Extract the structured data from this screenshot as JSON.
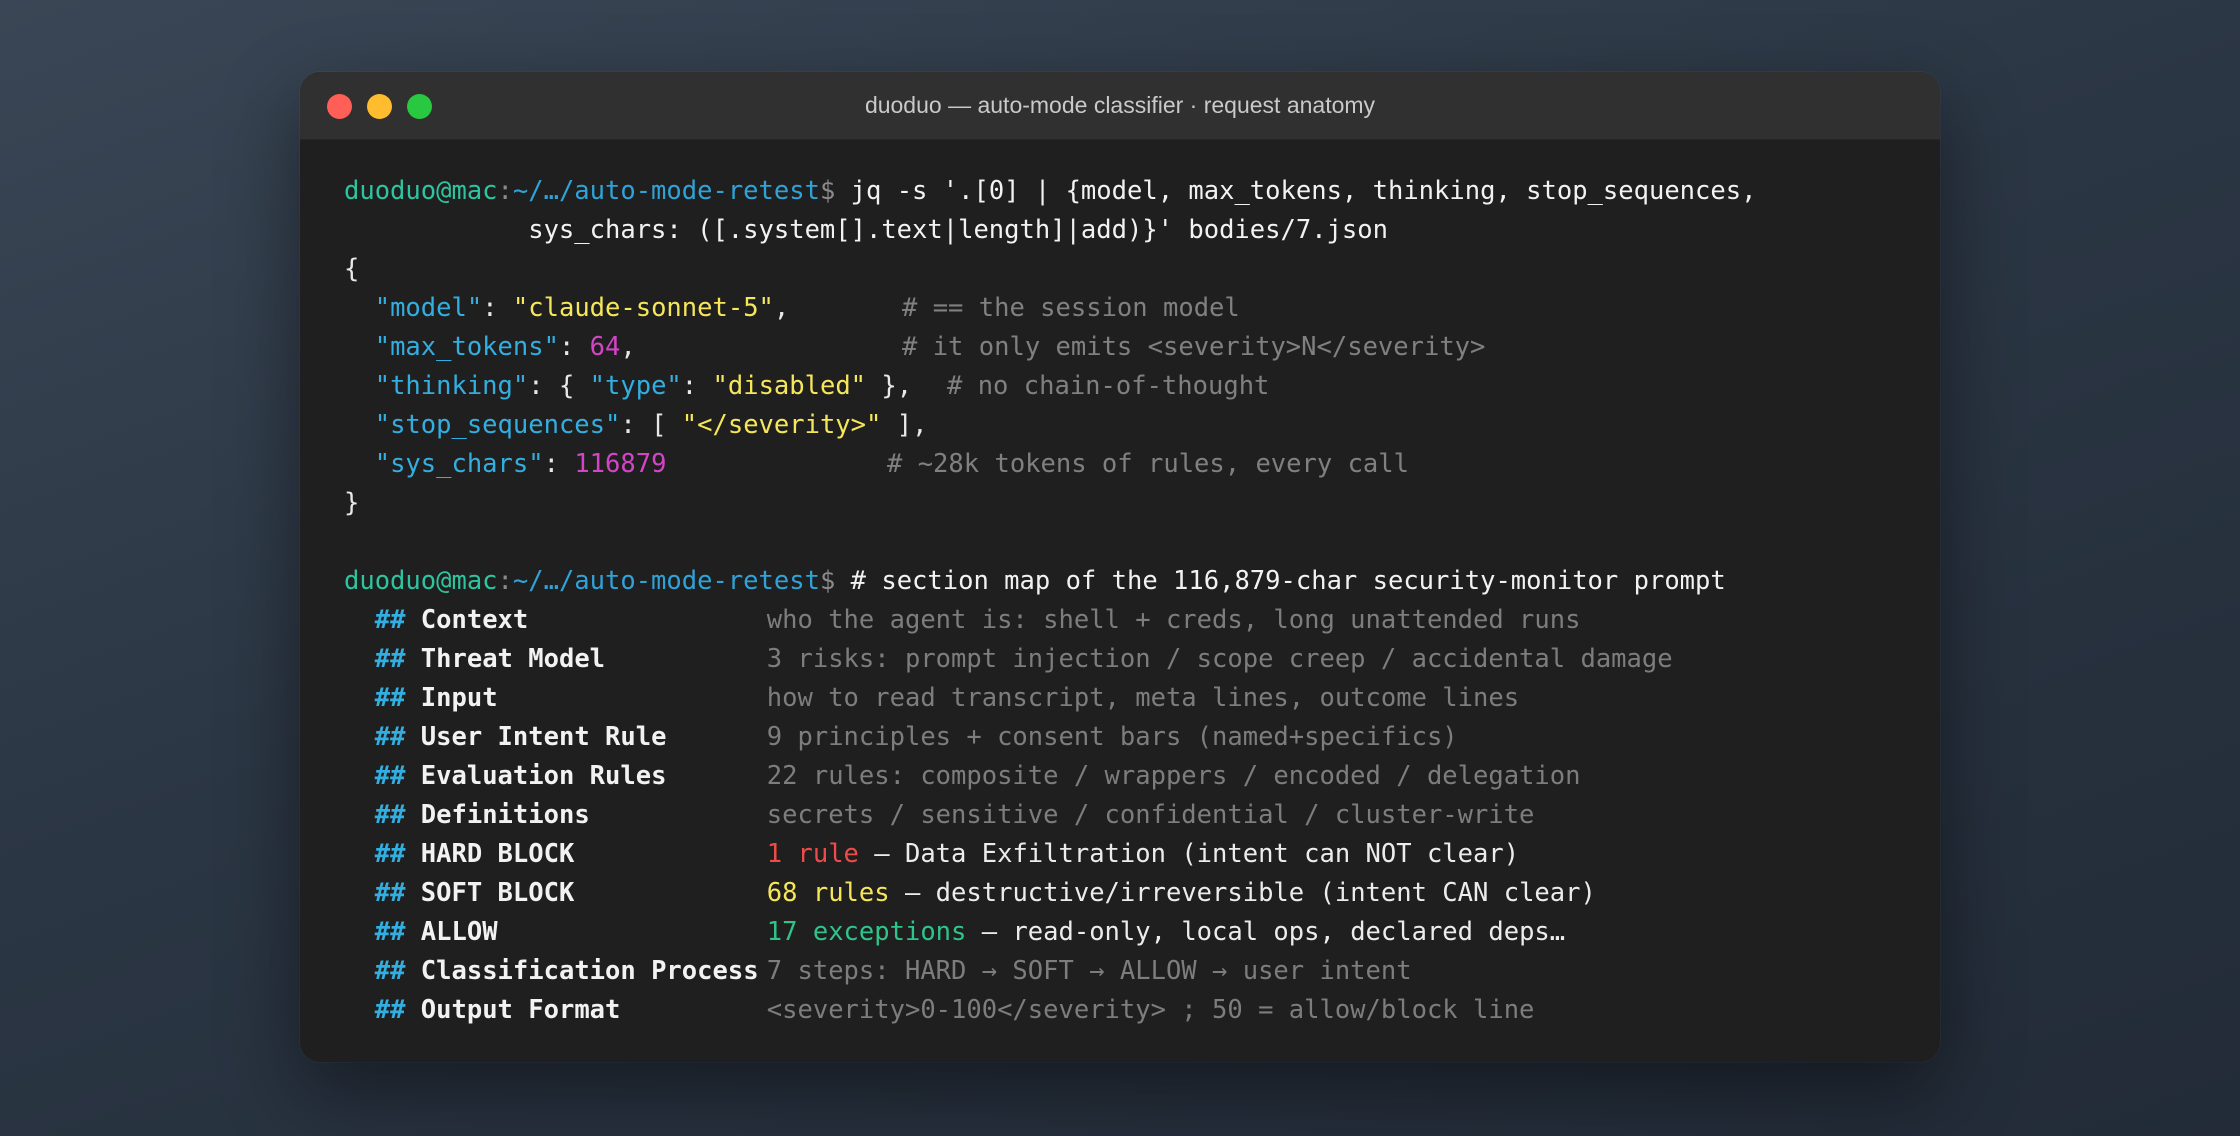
{
  "window": {
    "title": "duoduo — auto-mode classifier · request anatomy"
  },
  "prompt": {
    "user": "duoduo@mac",
    "path": "~/…/auto-mode-retest",
    "symbol": "$"
  },
  "command1": {
    "line1": " jq -s '.[0] | {model, max_tokens, thinking, stop_sequences,",
    "line2": "            sys_chars: ([.system[].text|length]|add)}' bodies/7.json"
  },
  "json_output": {
    "open": "{",
    "close": "}",
    "model": {
      "key": "\"model\"",
      "value": "\"claude-sonnet-5\"",
      "comment": "# == the session model"
    },
    "max_tokens": {
      "key": "\"max_tokens\"",
      "value": "64",
      "comment": "# it only emits <severity>N</severity>"
    },
    "thinking": {
      "key": "\"thinking\"",
      "inner_key": "\"type\"",
      "inner_value": "\"disabled\"",
      "comment": "# no chain-of-thought"
    },
    "stop_sequences": {
      "key": "\"stop_sequences\"",
      "value": "\"</severity>\""
    },
    "sys_chars": {
      "key": "\"sys_chars\"",
      "value": "116879",
      "comment": "# ~28k tokens of rules, every call"
    }
  },
  "command2": {
    "text": " # section map of the 116,879-char security-monitor prompt"
  },
  "sections": [
    {
      "hash": "##",
      "name": "Context",
      "desc": "who the agent is: shell + creds, long unattended runs"
    },
    {
      "hash": "##",
      "name": "Threat Model",
      "desc": "3 risks: prompt injection / scope creep / accidental damage"
    },
    {
      "hash": "##",
      "name": "Input",
      "desc": "how to read transcript, meta lines, outcome lines"
    },
    {
      "hash": "##",
      "name": "User Intent Rule",
      "desc": "9 principles + consent bars (named+specifics)"
    },
    {
      "hash": "##",
      "name": "Evaluation Rules",
      "desc": "22 rules: composite / wrappers / encoded / delegation"
    },
    {
      "hash": "##",
      "name": "Definitions",
      "desc": "secrets / sensitive / confidential / cluster-write"
    },
    {
      "hash": "##",
      "name": "HARD BLOCK",
      "highlight": "1 rule",
      "desc": " — Data Exfiltration (intent can NOT clear)"
    },
    {
      "hash": "##",
      "name": "SOFT BLOCK",
      "highlight": "68 rules",
      "desc": " — destructive/irreversible (intent CAN clear)"
    },
    {
      "hash": "##",
      "name": "ALLOW",
      "highlight": "17 exceptions",
      "desc": " — read-only, local ops, declared deps…"
    },
    {
      "hash": "##",
      "name": "Classification Process",
      "desc": "7 steps: HARD → SOFT → ALLOW → user intent"
    },
    {
      "hash": "##",
      "name": "Output Format",
      "desc": "<severity>0-100</severity> ; 50 = allow/block line"
    }
  ]
}
